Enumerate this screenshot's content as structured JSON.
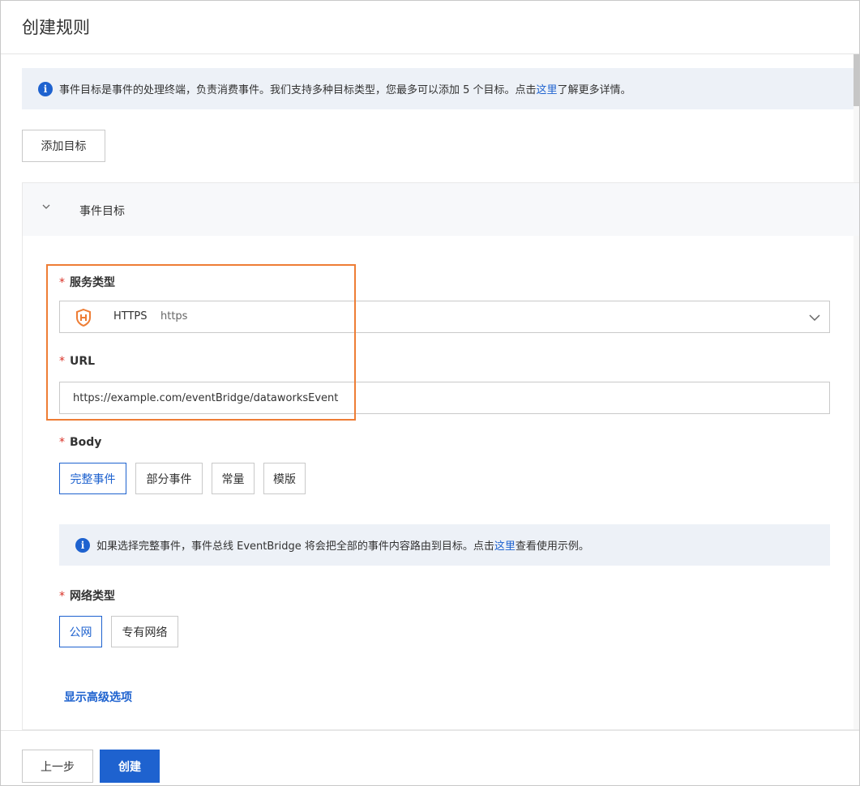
{
  "page": {
    "title": "创建规则"
  },
  "info_banner": {
    "text_before": "事件目标是事件的处理终端，负责消费事件。我们支持多种目标类型，您最多可以添加 5 个目标。点击",
    "link": "这里",
    "text_after": "了解更多详情。"
  },
  "add_target_button": "添加目标",
  "target_panel": {
    "title": "事件目标"
  },
  "service_type": {
    "required_mark": "*",
    "label": "服务类型",
    "selected_name": "HTTPS",
    "selected_sub": "https",
    "icon": "https-shield-icon"
  },
  "url": {
    "required_mark": "*",
    "label": "URL",
    "value": "https://example.com/eventBridge/dataworksEvent"
  },
  "body": {
    "required_mark": "*",
    "label": "Body",
    "options": [
      "完整事件",
      "部分事件",
      "常量",
      "模版"
    ],
    "selected": "完整事件"
  },
  "body_note": {
    "text_before": "如果选择完整事件，事件总线 EventBridge 将会把全部的事件内容路由到目标。点击",
    "link": "这里",
    "text_after": "查看使用示例。"
  },
  "network_type": {
    "required_mark": "*",
    "label": "网络类型",
    "options": [
      "公网",
      "专有网络"
    ],
    "selected": "公网"
  },
  "advanced_link": "显示高级选项",
  "footer": {
    "prev_label": "上一步",
    "create_label": "创建"
  },
  "colors": {
    "accent": "#1e62cf",
    "highlight_border": "#ee7d35",
    "required": "#d93026",
    "info_bg": "#edf1f7"
  }
}
